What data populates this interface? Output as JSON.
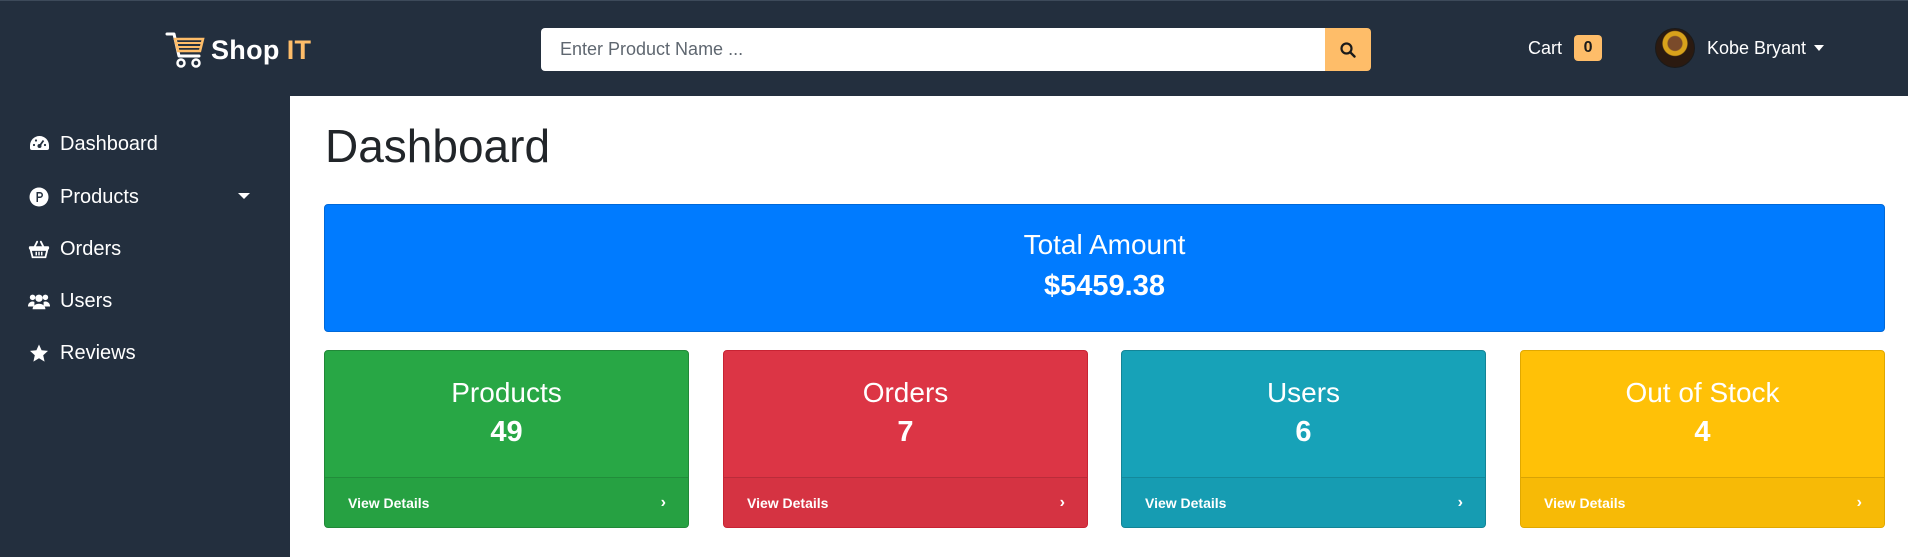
{
  "navbar": {
    "brand_main": "Shop",
    "brand_accent": "IT",
    "search_placeholder": "Enter Product Name ...",
    "cart_label": "Cart",
    "cart_count": "0",
    "user_name": "Kobe Bryant"
  },
  "sidebar": {
    "items": [
      {
        "label": "Dashboard",
        "icon": "tachometer-icon"
      },
      {
        "label": "Products",
        "icon": "product-icon"
      },
      {
        "label": "Orders",
        "icon": "shopping-basket-icon"
      },
      {
        "label": "Users",
        "icon": "users-icon"
      },
      {
        "label": "Reviews",
        "icon": "star-icon"
      }
    ]
  },
  "main": {
    "title": "Dashboard",
    "total": {
      "label": "Total Amount",
      "value": "$5459.38"
    },
    "cards": [
      {
        "label": "Products",
        "value": "49",
        "footer": "View Details",
        "color": "#28a745"
      },
      {
        "label": "Orders",
        "value": "7",
        "footer": "View Details",
        "color": "#dc3545"
      },
      {
        "label": "Users",
        "value": "6",
        "footer": "View Details",
        "color": "#17a2b8"
      },
      {
        "label": "Out of Stock",
        "value": "4",
        "footer": "View Details",
        "color": "#ffc107"
      }
    ]
  },
  "colors": {
    "navbar_bg": "#232f3e",
    "accent": "#febd69",
    "primary": "#007bff"
  }
}
